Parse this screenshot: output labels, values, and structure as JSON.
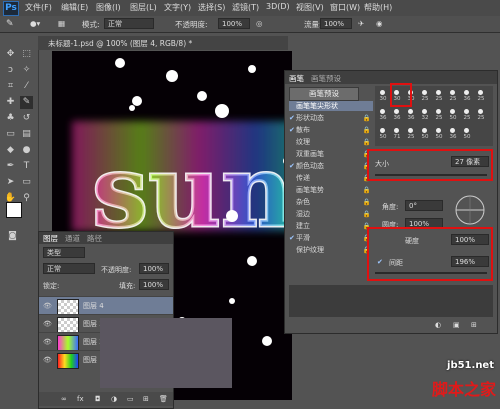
{
  "menubar": {
    "logo": "Ps",
    "items": [
      "文件(F)",
      "编辑(E)",
      "图像(I)",
      "图层(L)",
      "文字(Y)",
      "选择(S)",
      "滤镜(T)",
      "3D(D)",
      "视图(V)",
      "窗口(W)",
      "帮助(H)"
    ]
  },
  "options": {
    "mode_label": "模式:",
    "mode_value": "正常",
    "opacity_label": "不透明度:",
    "opacity_value": "100%",
    "flow_label": "流量:",
    "flow_value": "100%"
  },
  "document": {
    "tab_title": "未标题-1.psd @ 100% (图层 4, RGB/8) *"
  },
  "brush_panel": {
    "tabs": [
      "画笔",
      "画笔预设"
    ],
    "preset_button": "画笔预设",
    "options": [
      {
        "label": "画笔笔尖形状",
        "checked": false,
        "selected": true
      },
      {
        "label": "形状动态",
        "checked": true,
        "selected": false
      },
      {
        "label": "散布",
        "checked": true,
        "selected": false
      },
      {
        "label": "纹理",
        "checked": false,
        "selected": false
      },
      {
        "label": "双重画笔",
        "checked": false,
        "selected": false
      },
      {
        "label": "颜色动态",
        "checked": true,
        "selected": false
      },
      {
        "label": "传递",
        "checked": false,
        "selected": false
      },
      {
        "label": "画笔笔势",
        "checked": false,
        "selected": false
      },
      {
        "label": "杂色",
        "checked": false,
        "selected": false
      },
      {
        "label": "湿边",
        "checked": false,
        "selected": false
      },
      {
        "label": "建立",
        "checked": false,
        "selected": false
      },
      {
        "label": "平滑",
        "checked": true,
        "selected": false
      },
      {
        "label": "保护纹理",
        "checked": false,
        "selected": false
      }
    ],
    "tip_sizes": [
      "30",
      "30",
      "30",
      "25",
      "25",
      "25",
      "36",
      "25",
      "36",
      "36",
      "36",
      "32",
      "25",
      "50",
      "25",
      "25",
      "50",
      "71",
      "25",
      "50",
      "50",
      "36",
      "50"
    ],
    "size_label": "大小",
    "size_value": "27 像素",
    "angle_label": "角度:",
    "angle_value": "0°",
    "roundness_label": "圆度:",
    "roundness_value": "100%",
    "hardness_label": "硬度",
    "hardness_value": "100%",
    "spacing_label": "间距",
    "spacing_value": "196%",
    "spacing_checked": true
  },
  "layers_panel": {
    "tabs": [
      "图层",
      "通道",
      "路径"
    ],
    "kind_label": "类型",
    "blend_mode": "正常",
    "opacity_label": "不透明度:",
    "opacity_value": "100%",
    "lock_label": "锁定:",
    "fill_label": "填充:",
    "fill_value": "100%",
    "layers": [
      "图层 4",
      "图层 3",
      "图层 2",
      "图层 1"
    ]
  },
  "watermark": {
    "site": "jb51.net",
    "name": "脚本之家"
  },
  "colors": {
    "accent_red": "#e01010",
    "selected_option": "#6f7d96"
  }
}
